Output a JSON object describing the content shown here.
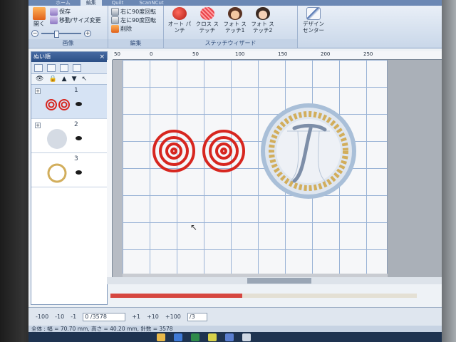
{
  "ribbon": {
    "tabs": [
      "ホーム",
      "編集",
      "Quilt",
      "ScanNCut"
    ],
    "active_tab": "編集",
    "image_group": {
      "label": "画像",
      "open": "開く",
      "save": "保存",
      "move_resize": "移動/サイズ変更",
      "zoom_minus": "−",
      "zoom_plus": "+"
    },
    "edit_group": {
      "label": "編集",
      "rotate_right": "右に90度回転",
      "rotate_left": "左に90度回転",
      "delete": "削除"
    },
    "wizard_group": {
      "label": "ステッチウィザード",
      "items": [
        "オート パンチ",
        "クロス ステッチ",
        "フォト ステッチ1",
        "フォト ステッチ2",
        "デザイン センター"
      ]
    }
  },
  "panel": {
    "title": "ぬい順",
    "close": "×",
    "layers": [
      {
        "number": "1",
        "expander": "+"
      },
      {
        "number": "2",
        "expander": "+"
      },
      {
        "number": "3",
        "expander": ""
      }
    ]
  },
  "ruler": {
    "labels": [
      "50",
      "0",
      "50",
      "100",
      "150",
      "200",
      "250"
    ]
  },
  "stitch_bar": {
    "buttons": [
      "-100",
      "-10",
      "-1"
    ],
    "current": "0 /3578",
    "buttons_plus": [
      "+1",
      "+10",
      "+100"
    ],
    "page": "/3"
  },
  "status": {
    "text": "全体 : 幅 = 70.70 mm, 高さ = 40.20 mm, 針数 = 3578"
  },
  "progress": {
    "fraction": 0.43
  },
  "colors": {
    "flower_red": "#d7261f",
    "ring_gold": "#d2ae5c",
    "ring_silver": "#a9bfd8",
    "progress_red": "#d64740"
  }
}
